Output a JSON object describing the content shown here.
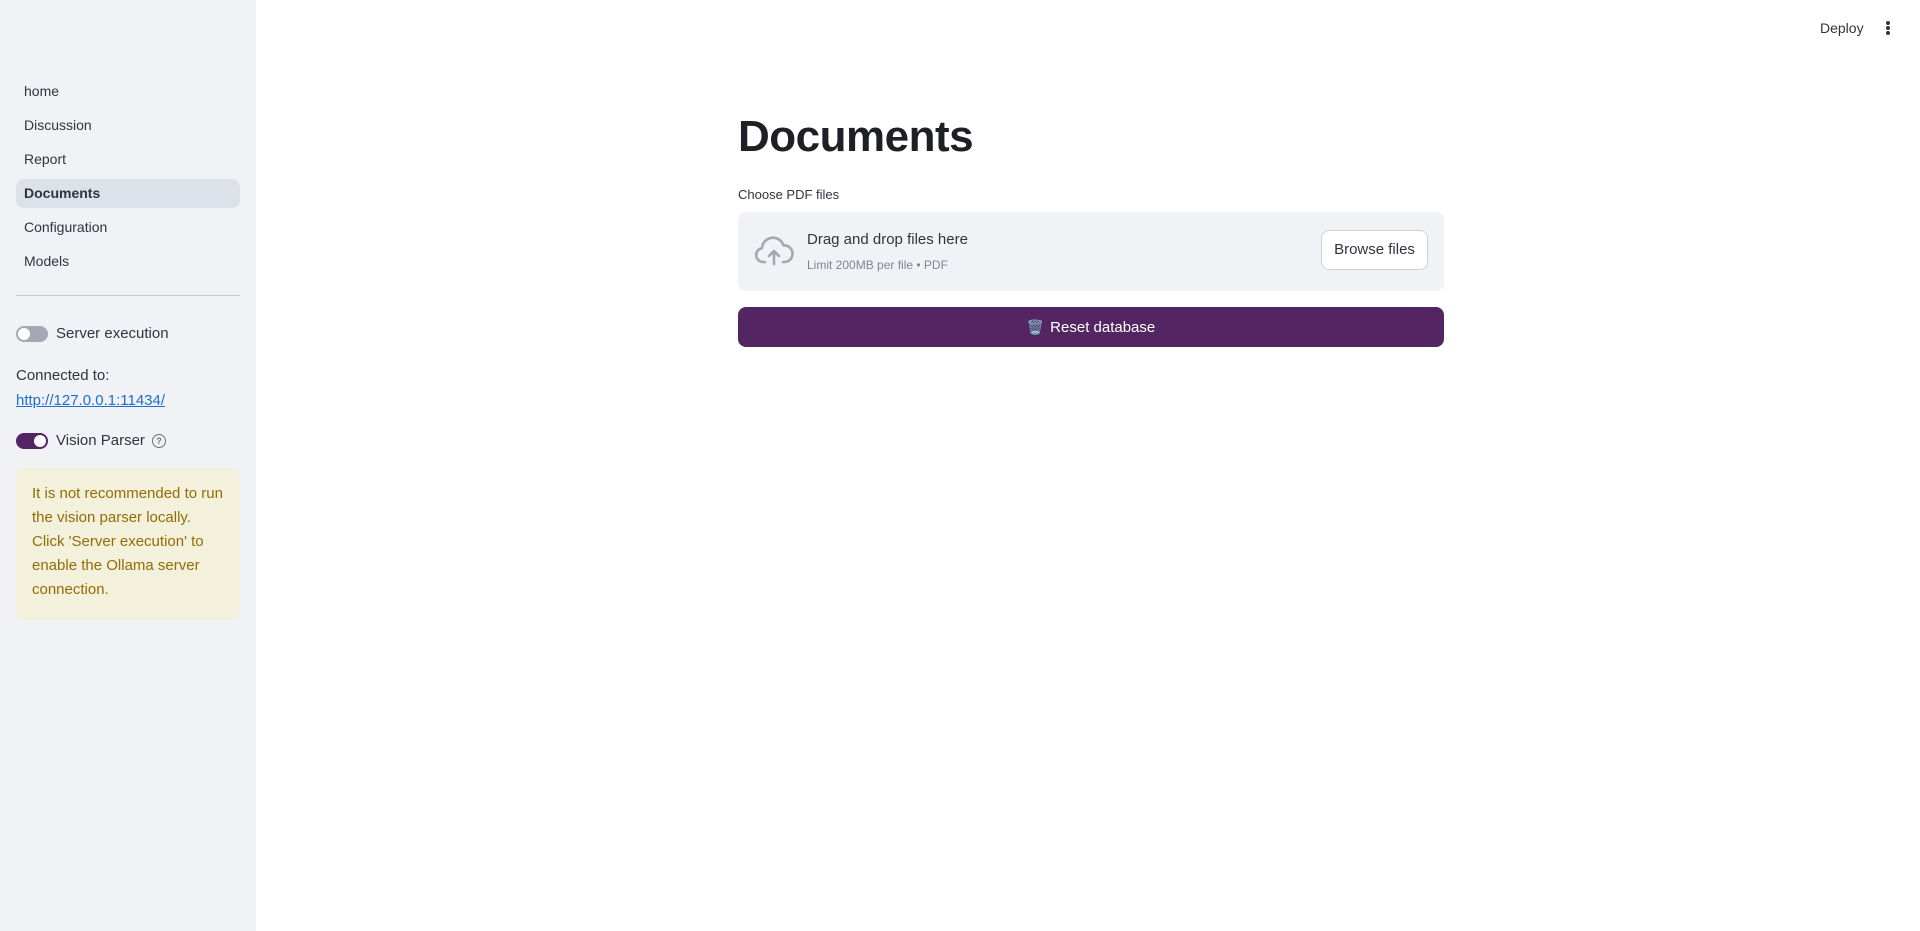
{
  "sidebar": {
    "nav": [
      {
        "label": "home"
      },
      {
        "label": "Discussion"
      },
      {
        "label": "Report"
      },
      {
        "label": "Documents",
        "active": true
      },
      {
        "label": "Configuration"
      },
      {
        "label": "Models"
      }
    ],
    "server_execution": {
      "label": "Server execution",
      "checked": false
    },
    "connected_label": "Connected to:",
    "connected_url": "http://127.0.0.1:11434/",
    "vision_parser": {
      "label": "Vision Parser",
      "checked": true,
      "help_icon": "question-circle-icon"
    },
    "warning": "It is not recommended to run the vision parser locally. Click 'Server execution' to enable the Ollama server connection."
  },
  "header": {
    "deploy_label": "Deploy",
    "menu_icon": "vertical-dots-icon"
  },
  "main": {
    "title": "Documents",
    "uploader": {
      "label": "Choose PDF files",
      "drop_title": "Drag and drop files here",
      "drop_subtitle": "Limit 200MB per file • PDF",
      "browse_label": "Browse files",
      "icon": "cloud-upload-icon"
    },
    "reset_button": {
      "icon": "🗑️",
      "label": "Reset database"
    }
  },
  "colors": {
    "primary": "#532663",
    "sidebar_bg": "#f0f2f6",
    "warning_bg": "#f3f1dc",
    "warning_text": "#926c05",
    "link": "#1c6fd1"
  }
}
